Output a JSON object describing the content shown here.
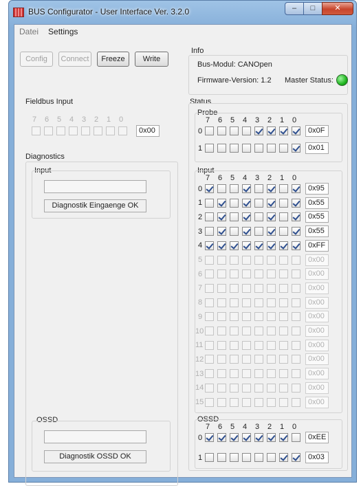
{
  "window": {
    "title": "BUS Configurator - User Interface   Ver. 3.2.0"
  },
  "menu": [
    {
      "label": "Datei",
      "enabled": false
    },
    {
      "label": "Settings",
      "enabled": true
    }
  ],
  "toolbar": {
    "config_label": "Config",
    "connect_label": "Connect",
    "freeze_label": "Freeze",
    "write_label": "Write"
  },
  "info": {
    "label": "Info",
    "bus_modul": "Bus-Modul: CANOpen",
    "firmware": "Firmware-Version: 1.2",
    "master_status_label": "Master Status:",
    "master_status_color": "#1fb51f"
  },
  "bit_headers": [
    "7",
    "6",
    "5",
    "4",
    "3",
    "2",
    "1",
    "0"
  ],
  "fieldbus_input": {
    "label": "Fieldbus Input",
    "bits": [
      false,
      false,
      false,
      false,
      false,
      false,
      false,
      false
    ],
    "value": "0x00"
  },
  "diagnostics": {
    "label": "Diagnostics",
    "input_label": "Input",
    "input_value": "",
    "input_message": "Diagnostik Eingaenge OK",
    "ossd_label": "OSSD",
    "ossd_value": "",
    "ossd_message": "Diagnostik OSSD OK"
  },
  "status": {
    "label": "Status",
    "probe": {
      "label": "Probe",
      "rows": [
        {
          "index": "0",
          "bits": [
            false,
            false,
            false,
            false,
            true,
            true,
            true,
            true
          ],
          "value": "0x0F"
        },
        {
          "index": "1",
          "bits": [
            false,
            false,
            false,
            false,
            false,
            false,
            false,
            true
          ],
          "value": "0x01"
        }
      ]
    },
    "input": {
      "label": "Input",
      "rows": [
        {
          "index": "0",
          "active": true,
          "bits": [
            true,
            false,
            false,
            true,
            false,
            true,
            false,
            true
          ],
          "value": "0x95"
        },
        {
          "index": "1",
          "active": true,
          "bits": [
            false,
            true,
            false,
            true,
            false,
            true,
            false,
            true
          ],
          "value": "0x55"
        },
        {
          "index": "2",
          "active": true,
          "bits": [
            false,
            true,
            false,
            true,
            false,
            true,
            false,
            true
          ],
          "value": "0x55"
        },
        {
          "index": "3",
          "active": true,
          "bits": [
            false,
            true,
            false,
            true,
            false,
            true,
            false,
            true
          ],
          "value": "0x55"
        },
        {
          "index": "4",
          "active": true,
          "bits": [
            true,
            true,
            true,
            true,
            true,
            true,
            true,
            true
          ],
          "value": "0xFF"
        },
        {
          "index": "5",
          "active": false,
          "bits": [
            false,
            false,
            false,
            false,
            false,
            false,
            false,
            false
          ],
          "value": "0x00"
        },
        {
          "index": "6",
          "active": false,
          "bits": [
            false,
            false,
            false,
            false,
            false,
            false,
            false,
            false
          ],
          "value": "0x00"
        },
        {
          "index": "7",
          "active": false,
          "bits": [
            false,
            false,
            false,
            false,
            false,
            false,
            false,
            false
          ],
          "value": "0x00"
        },
        {
          "index": "8",
          "active": false,
          "bits": [
            false,
            false,
            false,
            false,
            false,
            false,
            false,
            false
          ],
          "value": "0x00"
        },
        {
          "index": "9",
          "active": false,
          "bits": [
            false,
            false,
            false,
            false,
            false,
            false,
            false,
            false
          ],
          "value": "0x00"
        },
        {
          "index": "10",
          "active": false,
          "bits": [
            false,
            false,
            false,
            false,
            false,
            false,
            false,
            false
          ],
          "value": "0x00"
        },
        {
          "index": "11",
          "active": false,
          "bits": [
            false,
            false,
            false,
            false,
            false,
            false,
            false,
            false
          ],
          "value": "0x00"
        },
        {
          "index": "12",
          "active": false,
          "bits": [
            false,
            false,
            false,
            false,
            false,
            false,
            false,
            false
          ],
          "value": "0x00"
        },
        {
          "index": "13",
          "active": false,
          "bits": [
            false,
            false,
            false,
            false,
            false,
            false,
            false,
            false
          ],
          "value": "0x00"
        },
        {
          "index": "14",
          "active": false,
          "bits": [
            false,
            false,
            false,
            false,
            false,
            false,
            false,
            false
          ],
          "value": "0x00"
        },
        {
          "index": "15",
          "active": false,
          "bits": [
            false,
            false,
            false,
            false,
            false,
            false,
            false,
            false
          ],
          "value": "0x00"
        }
      ]
    },
    "ossd": {
      "label": "OSSD",
      "rows": [
        {
          "index": "0",
          "bits": [
            true,
            true,
            true,
            true,
            true,
            true,
            true,
            false
          ],
          "value": "0xEE"
        },
        {
          "index": "1",
          "bits": [
            false,
            false,
            false,
            false,
            false,
            false,
            true,
            true
          ],
          "value": "0x03"
        }
      ]
    }
  }
}
